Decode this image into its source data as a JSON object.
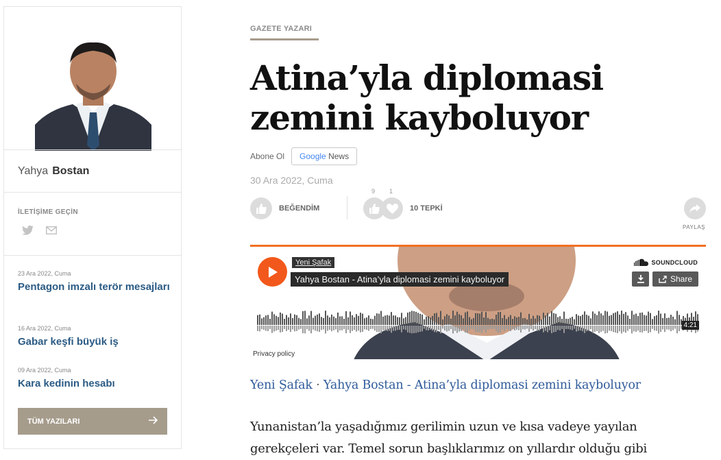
{
  "sidebar": {
    "author_first": "Yahya",
    "author_last": "Bostan",
    "contact_title": "İLETİŞİME GEÇİN",
    "recent_posts": [
      {
        "date": "23 Ara 2022, Cuma",
        "title": "Pentagon imzalı terör mesajları"
      },
      {
        "date": "16 Ara 2022, Cuma",
        "title": "Gabar keşfi büyük iş"
      },
      {
        "date": "09 Ara 2022, Cuma",
        "title": "Kara kedinin hesabı"
      }
    ],
    "all_posts_label": "TÜM YAZILARI",
    "icons": [
      "twitter-icon",
      "mail-icon",
      "arrow-right-icon"
    ]
  },
  "article": {
    "category": "GAZETE YAZARI",
    "headline": "Atina’yla diplomasi zemini kayboluyor",
    "subscribe_label": "Abone Ol",
    "google_news": {
      "google": "Google",
      "news": "News"
    },
    "date": "30 Ara 2022, Cuma",
    "like_label": "BEĞENDİM",
    "reaction_counts": {
      "like": "9",
      "love": "1"
    },
    "reactions_total": "10 TEPKİ",
    "share_label": "PAYLAŞ",
    "audio_link": {
      "source": "Yeni Şafak",
      "separator": "·",
      "title": "Yahya Bostan - Atina’yla diplomasi zemini kayboluyor"
    },
    "body_lines": [
      "Yunanistan’la yaşadığımız gerilimin uzun ve kısa vadeye yayılan",
      "gerekçeleri var. Temel sorun başlıklarımız on yıllardır olduğu gibi"
    ]
  },
  "player": {
    "user": "Yeni Şafak",
    "track_title": "Yahya Bostan - Atina’yla diplomasi zemini kayboluyor",
    "brand": "SOUNDCLOUD",
    "share_label": "Share",
    "duration": "4:21",
    "privacy": "Privacy policy"
  },
  "colors": {
    "accent_orange": "#f26f21",
    "link_blue": "#2b5b84",
    "button_taupe": "#a69c8c"
  }
}
